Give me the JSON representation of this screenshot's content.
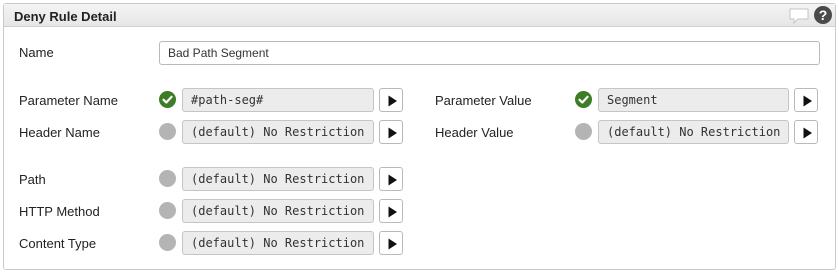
{
  "panel": {
    "title": "Deny Rule Detail",
    "help_glyph": "?"
  },
  "name": {
    "label": "Name",
    "value": "Bad Path Segment"
  },
  "rules": {
    "parameter_name": {
      "label": "Parameter Name",
      "value": "#path-seg#",
      "status": "configured",
      "status_icon": "check-circle-icon"
    },
    "parameter_value": {
      "label": "Parameter Value",
      "value": "Segment",
      "status": "configured",
      "status_icon": "check-circle-icon"
    },
    "header_name": {
      "label": "Header Name",
      "value": "(default) No Restriction",
      "status": "default",
      "status_icon": "gray-circle-icon"
    },
    "header_value": {
      "label": "Header Value",
      "value": "(default) No Restriction",
      "status": "default",
      "status_icon": "gray-circle-icon"
    },
    "path": {
      "label": "Path",
      "value": "(default) No Restriction",
      "status": "default",
      "status_icon": "gray-circle-icon"
    },
    "http_method": {
      "label": "HTTP Method",
      "value": "(default) No Restriction",
      "status": "default",
      "status_icon": "gray-circle-icon"
    },
    "content_type": {
      "label": "Content Type",
      "value": "(default) No Restriction",
      "status": "default",
      "status_icon": "gray-circle-icon"
    }
  },
  "icons": {
    "edit_button": "play-icon",
    "comment": "comment-icon",
    "help": "help-icon"
  },
  "colors": {
    "configured": "#3e7d27",
    "default": "#b4b4b4",
    "help": "#4a4a4a"
  }
}
